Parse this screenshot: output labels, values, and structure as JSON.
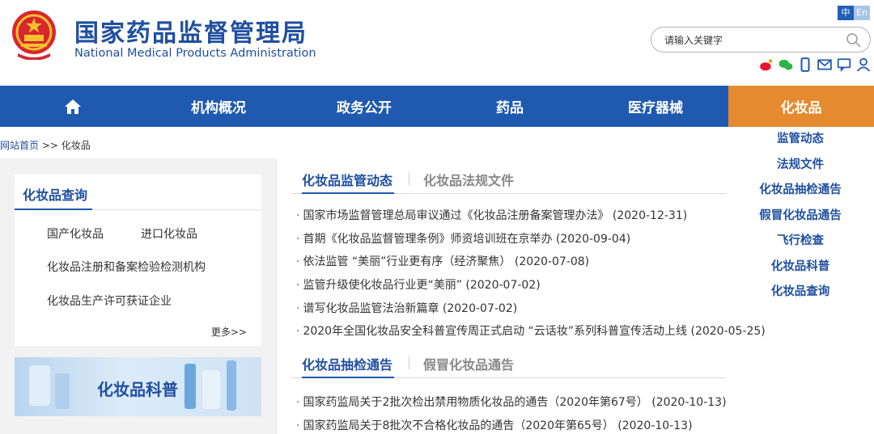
{
  "header": {
    "title_cn": "国家药品监督管理局",
    "title_en": "National Medical Products Administration",
    "lang_zh": "中",
    "lang_en": "En",
    "search_placeholder": "请输入关键字"
  },
  "nav": {
    "items": [
      "机构概况",
      "政务公开",
      "药品",
      "医疗器械",
      "化妆品"
    ],
    "active": "化妆品"
  },
  "submenu": [
    "监管动态",
    "法规文件",
    "化妆品抽检通告",
    "假冒化妆品通告",
    "飞行检查",
    "化妆品科普",
    "化妆品查询"
  ],
  "breadcrumb": {
    "home": "网站首页",
    "sep": " >> ",
    "current": "化妆品"
  },
  "query": {
    "title": "化妆品查询",
    "links": [
      "国产化妆品",
      "进口化妆品",
      "化妆品注册和备案检验检测机构",
      "化妆品生产许可获证企业"
    ],
    "more": "更多>>"
  },
  "banner": {
    "text": "化妆品科普"
  },
  "section1": {
    "tabs": [
      "化妆品监管动态",
      "化妆品法规文件"
    ],
    "items": [
      "国家市场监督管理总局审议通过《化妆品注册备案管理办法》 (2020-12-31)",
      "首期《化妆品监督管理条例》师资培训班在京举办 (2020-09-04)",
      "依法监管 “美丽”行业更有序（经济聚焦） (2020-07-08)",
      "监管升级使化妆品行业更“美丽” (2020-07-02)",
      "谱写化妆品监管法治新篇章 (2020-07-02)",
      "2020年全国化妆品安全科普宣传周正式启动 “云话妆”系列科普宣传活动上线 (2020-05-25)"
    ]
  },
  "section2": {
    "tabs": [
      "化妆品抽检通告",
      "假冒化妆品通告"
    ],
    "items": [
      "国家药监局关于2批次检出禁用物质化妆品的通告（2020年第67号） (2020-10-13)",
      "国家药监局关于8批次不合格化妆品的通告（2020年第65号） (2020-10-13)"
    ]
  },
  "colors": {
    "primary": "#1f5ab0",
    "active": "#e58a2e",
    "title": "#1f4fa0"
  }
}
